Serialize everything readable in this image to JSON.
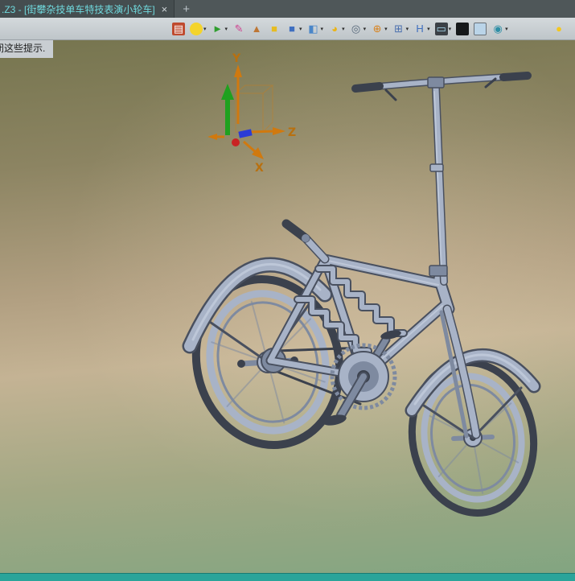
{
  "colors": {
    "accent_teal": "#2aa49a",
    "tab_text": "#6fd8dc",
    "axis_orange": "#d0790f",
    "axis_green": "#1fa11f",
    "marker_red": "#c92323",
    "marker_blue": "#2b3bd6",
    "bike_body": "#a8b3c7",
    "bike_shade": "#7e8aa0",
    "bike_light": "#ccd4e2",
    "bike_dark": "#3b414d",
    "bike_outline": "#49505f"
  },
  "tab_bar": {
    "active_tab_title": ".Z3 - [街攀杂技单车特技表演小轮车]",
    "close_label": "×",
    "new_tab_label": "+"
  },
  "toolbar": {
    "caret_glyph": "▾",
    "icons": [
      {
        "name": "view-manager-icon",
        "glyph": "▤",
        "color": "#ffffff",
        "bg": "#bf4a2e",
        "caret": false
      },
      {
        "name": "bulb-icon",
        "glyph": "",
        "color": "#7a5c00",
        "bg": "#f4d42c",
        "round": true,
        "caret": true
      },
      {
        "name": "select-arrow-icon",
        "glyph": "►",
        "color": "#2f9e2f",
        "caret": true
      },
      {
        "name": "sketch-pencil-icon",
        "glyph": "✎",
        "color": "#cf3f8f",
        "caret": false
      },
      {
        "name": "cone-icon",
        "glyph": "▲",
        "color": "#bd7634",
        "caret": false
      },
      {
        "name": "box-yellow-icon",
        "glyph": "■",
        "color": "#e6bc22",
        "caret": false
      },
      {
        "name": "cube-blue-icon",
        "glyph": "■",
        "color": "#3f6fc0",
        "caret": true
      },
      {
        "name": "appearance-icon",
        "glyph": "◧",
        "color": "#4a86c8",
        "caret": true
      },
      {
        "name": "section-pie-icon",
        "glyph": "◕",
        "color": "#eab417",
        "caret": true
      },
      {
        "name": "zoom-icon",
        "glyph": "◎",
        "color": "#56687a",
        "caret": true
      },
      {
        "name": "point-snap-icon",
        "glyph": "⊕",
        "color": "#d8821c",
        "caret": true
      },
      {
        "name": "window-layout-icon",
        "glyph": "⊞",
        "color": "#4a6fae",
        "caret": true
      },
      {
        "name": "ruler-icon",
        "glyph": "H",
        "color": "#3f6fbe",
        "caret": true
      },
      {
        "name": "display-mode-icon",
        "glyph": "▭",
        "color": "#aadcf0",
        "bg": "#3b4046",
        "caret": true
      },
      {
        "name": "swatch-black-icon",
        "glyph": "",
        "color": "#000000",
        "bg": "#15181a",
        "caret": false
      },
      {
        "name": "swatch-blue-icon",
        "glyph": "",
        "color": "#000000",
        "bg": "#bad4e8",
        "border": true,
        "caret": false
      },
      {
        "name": "visibility-icon",
        "glyph": "◉",
        "color": "#2f8fa6",
        "caret": true
      },
      {
        "name": "hint-bulb-icon",
        "glyph": "●",
        "color": "#f4c71e",
        "push_right": true,
        "caret": false
      }
    ]
  },
  "hint": {
    "text": "闭这些提示."
  },
  "viewport": {
    "triad": {
      "x_label": "X",
      "y_label": "Y",
      "z_label": "Z"
    }
  }
}
